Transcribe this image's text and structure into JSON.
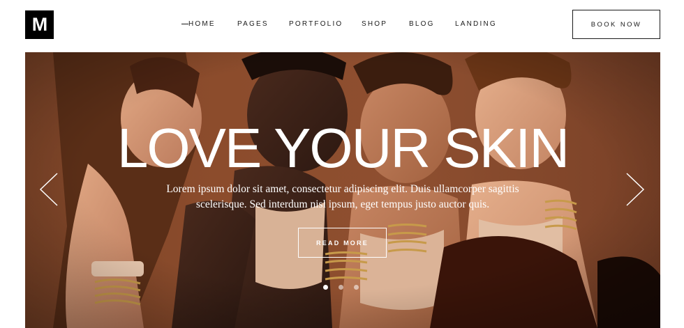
{
  "header": {
    "logo_text": "M",
    "nav": [
      {
        "label": "HOME",
        "active": true
      },
      {
        "label": "PAGES",
        "active": false
      },
      {
        "label": "PORTFOLIO",
        "active": false
      },
      {
        "label": "SHOP",
        "active": false
      },
      {
        "label": "BLOG",
        "active": false
      },
      {
        "label": "LANDING",
        "active": false
      }
    ],
    "book_label": "BOOK NOW"
  },
  "hero": {
    "title": "LOVE YOUR SKIN",
    "text_line1": "Lorem ipsum dolor sit amet, consectetur adipiscing elit. Duis ullamcorper sagittis",
    "text_line2": "scelerisque. Sed interdum nisl ipsum, eget tempus justo auctor quis.",
    "button_label": "READ MORE",
    "slides": 3,
    "active_slide": 1,
    "prev_icon": "chevron-left-icon",
    "next_icon": "chevron-right-icon"
  },
  "colors": {
    "background_brown": "#8c4c2c",
    "text": "#1a1a1a",
    "white": "#ffffff"
  }
}
